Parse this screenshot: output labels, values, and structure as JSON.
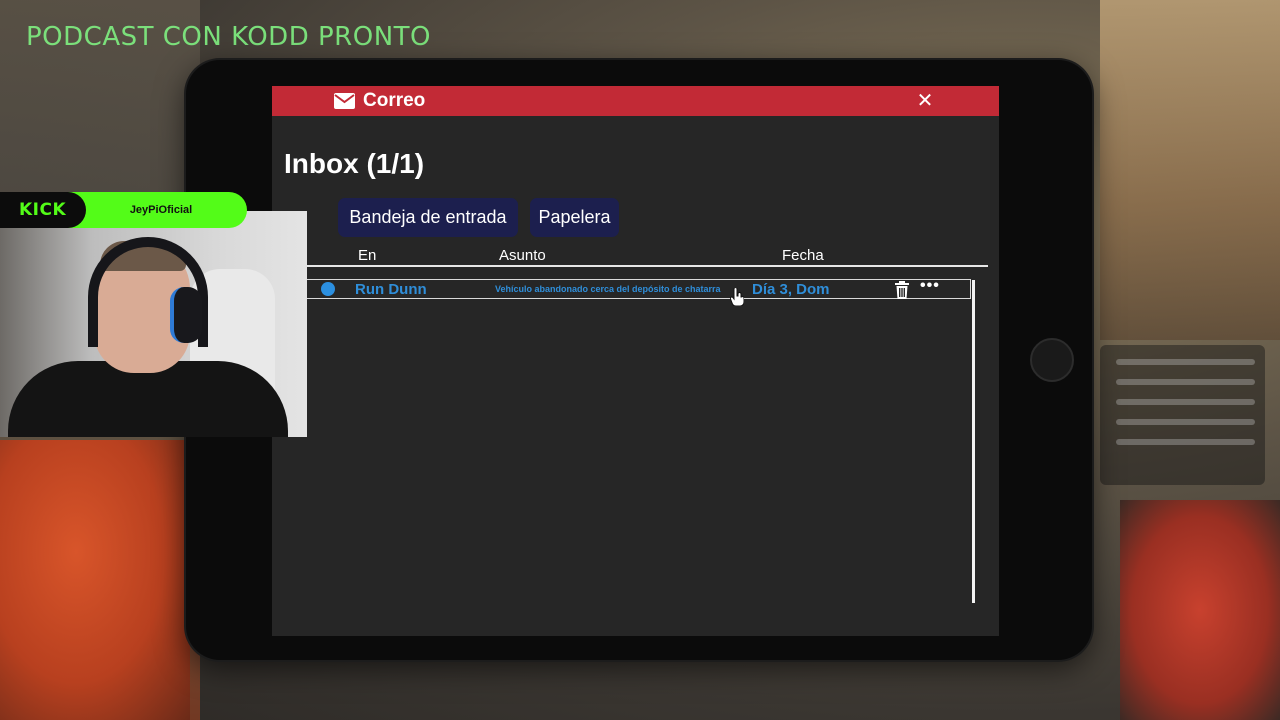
{
  "stream": {
    "title": "PODCAST CON KODD PRONTO",
    "platform_logo": "KICK",
    "username": "JeyPiOficial"
  },
  "app": {
    "window_title": "Correo",
    "close_label": "✕",
    "inbox_heading": "Inbox (1/1)",
    "tabs": [
      {
        "label": "Bandeja de entrada"
      },
      {
        "label": "Papelera"
      }
    ],
    "columns": {
      "from": "En",
      "subject": "Asunto",
      "date": "Fecha"
    },
    "emails": [
      {
        "unread": true,
        "sender": "Run Dunn",
        "subject": "Vehículo abandonado cerca del depósito de chatarra",
        "date": "Día 3, Dom",
        "more_label": "•••"
      }
    ]
  },
  "colors": {
    "titlebar": "#c22a36",
    "tab_bg": "#1c1f4e",
    "link_blue": "#2f8ed9",
    "kick_green": "#53fc18",
    "stream_title": "#7be07b"
  },
  "icons": {
    "mail": "envelope-icon",
    "close": "close-icon",
    "delete": "trash-icon",
    "more": "more-dots-icon",
    "unread": "unread-dot-icon",
    "cursor": "hand-cursor-icon"
  }
}
